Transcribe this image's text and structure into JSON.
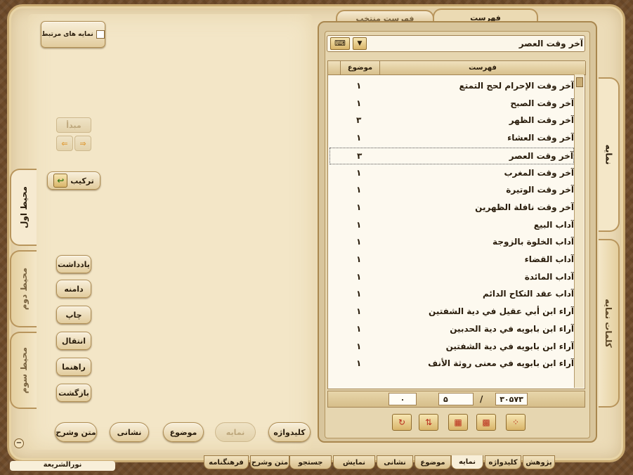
{
  "top_tabs": {
    "active": "فهرست",
    "inactive": "فهرست منتخب"
  },
  "search": {
    "value": "آخر وقت العصر"
  },
  "table": {
    "col_title": "فهرست",
    "col_count": "موضوع",
    "rows": [
      {
        "title": "آخر وقت الإحرام لحج التمتع",
        "count": "۱"
      },
      {
        "title": "آخر وقت الصبح",
        "count": "۱"
      },
      {
        "title": "آخر وقت الظهر",
        "count": "۳"
      },
      {
        "title": "آخر وقت العشاء",
        "count": "۱"
      },
      {
        "title": "آخر وقت العصر",
        "count": "۳",
        "selected": true
      },
      {
        "title": "آخر وقت المغرب",
        "count": "۱"
      },
      {
        "title": "آخر وقت الوتيرة",
        "count": "۱"
      },
      {
        "title": "آخر وقت نافلة الظهرين",
        "count": "۱"
      },
      {
        "title": "آداب البيع",
        "count": "۱"
      },
      {
        "title": "آداب الخلوة بالزوجة",
        "count": "۱"
      },
      {
        "title": "آداب القضاء",
        "count": "۱"
      },
      {
        "title": "آداب المائدة",
        "count": "۱"
      },
      {
        "title": "آداب عقد النكاح الدائم",
        "count": "۱"
      },
      {
        "title": "آراء ابن أبي عقيل في دية الشفتين",
        "count": "۱"
      },
      {
        "title": "آراء ابن بابويه في دية الحدبين",
        "count": "۱"
      },
      {
        "title": "آراء ابن بابويه في دية الشفتين",
        "count": "۱"
      },
      {
        "title": "آراء ابن بابويه في معنى روثة الأنف",
        "count": "۱"
      }
    ]
  },
  "status": {
    "total": "۳۰۵۷۳",
    "separator": "/",
    "position": "۵",
    "selected_count": "۰"
  },
  "right_tabs": {
    "top": "نمايه",
    "bottom": "كلمات نمايه"
  },
  "left_tabs": [
    "محيط اول",
    "محيط دوم",
    "محيط سوم"
  ],
  "filter_checkbox": {
    "label": "نمايه هاى مرتبط"
  },
  "nav": {
    "origin": "مبدأ",
    "prev": "⇐",
    "next": "⇒"
  },
  "combine": {
    "label": "تركيب"
  },
  "side_buttons": [
    "يادداشت",
    "دامنه",
    "چاپ",
    "انتقال",
    "راهنما",
    "بازگشت"
  ],
  "bottom_buttons": {
    "matn": "متن وشرح",
    "neshani": "نشانى",
    "mozoo": "موضوع",
    "namaye": "نمايه",
    "kelidvajeh": "كليدواژه"
  },
  "bottom_tabs": [
    "پژوهش",
    "كليدواژه",
    "نمايه",
    "موضوع",
    "نشانى",
    "نمايش",
    "جستجو",
    "متن وشرح",
    "فرهنگنامه"
  ],
  "app_title": "نورالشريعة"
}
